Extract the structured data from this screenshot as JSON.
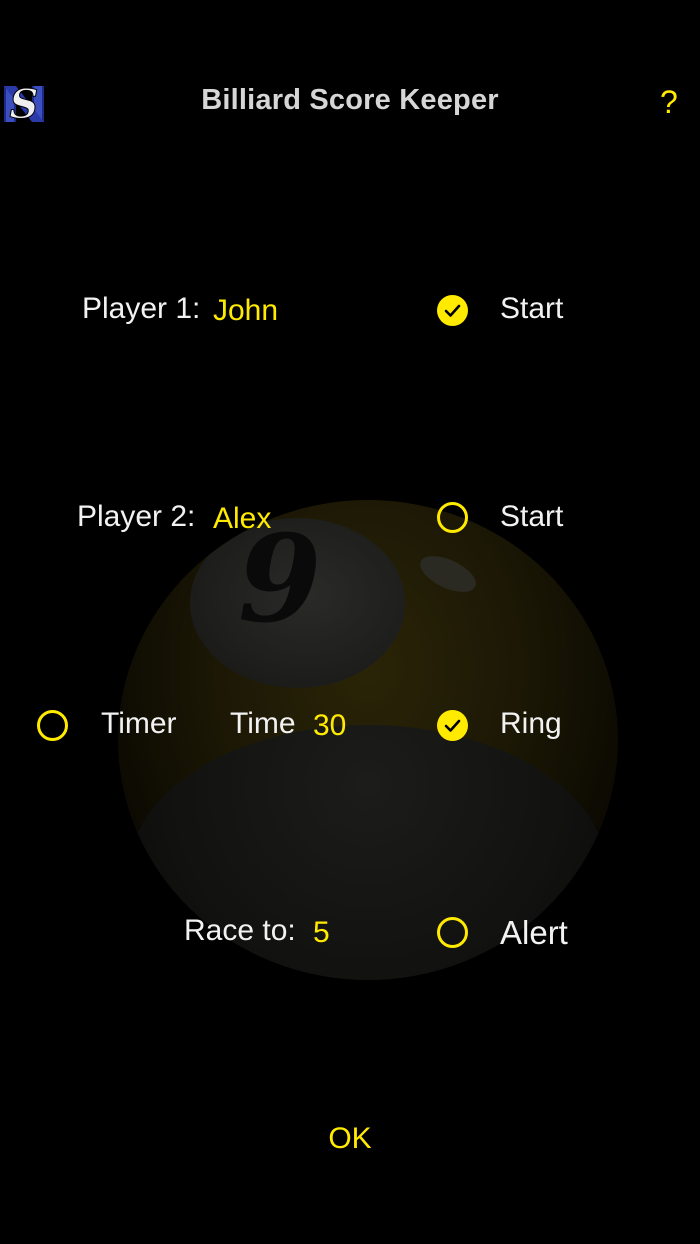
{
  "header": {
    "title": "Billiard Score Keeper",
    "help_label": "?",
    "logo_text": "S"
  },
  "player1": {
    "label": "Player 1:",
    "name": "John",
    "start_label": "Start",
    "start_checked": true
  },
  "player2": {
    "label": "Player 2:",
    "name": "Alex",
    "start_label": "Start",
    "start_checked": false
  },
  "timer": {
    "label": "Timer",
    "checked": false,
    "time_label": "Time",
    "time_value": "30"
  },
  "ring": {
    "label": "Ring",
    "checked": true
  },
  "race": {
    "label": "Race to:",
    "value": "5"
  },
  "alert": {
    "label": "Alert",
    "checked": false
  },
  "footer": {
    "ok_label": "OK"
  },
  "colors": {
    "accent": "#ffea00",
    "text": "#f2f2f2",
    "title": "#d6d6d6",
    "background": "#000000"
  }
}
